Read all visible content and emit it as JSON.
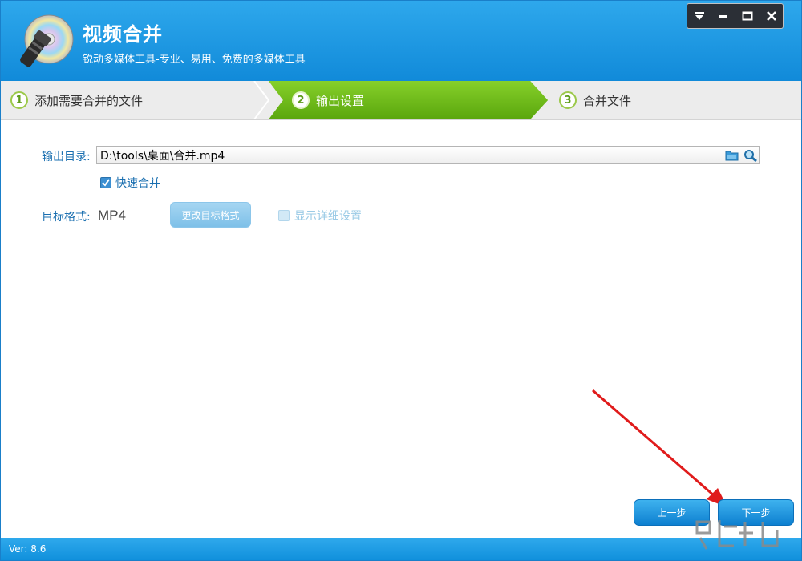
{
  "header": {
    "title": "视频合并",
    "subtitle": "锐动多媒体工具-专业、易用、免费的多媒体工具",
    "controls": [
      "menu-icon",
      "minimize-icon",
      "maximize-icon",
      "close-icon"
    ]
  },
  "steps": [
    {
      "number": "1",
      "label": "添加需要合并的文件",
      "active": false
    },
    {
      "number": "2",
      "label": "输出设置",
      "active": true
    },
    {
      "number": "3",
      "label": "合并文件",
      "active": false
    }
  ],
  "output": {
    "label": "输出目录:",
    "value": "D:\\tools\\桌面\\合并.mp4",
    "icons": [
      "folder-icon",
      "search-icon"
    ]
  },
  "fast_merge": {
    "label": "快速合并",
    "checked": true
  },
  "format": {
    "label": "目标格式:",
    "value": "MP4",
    "change_button": "更改目标格式",
    "detail_label": "显示详细设置",
    "detail_checked": false,
    "detail_enabled": false
  },
  "nav": {
    "prev": "上一步",
    "next": "下一步"
  },
  "status": {
    "version": "Ver: 8.6"
  },
  "colors": {
    "header_blue": "#1a9be6",
    "active_step_green": "#6fba16",
    "label_blue": "#1a6fb0",
    "annotation_red": "#e01b1b"
  }
}
